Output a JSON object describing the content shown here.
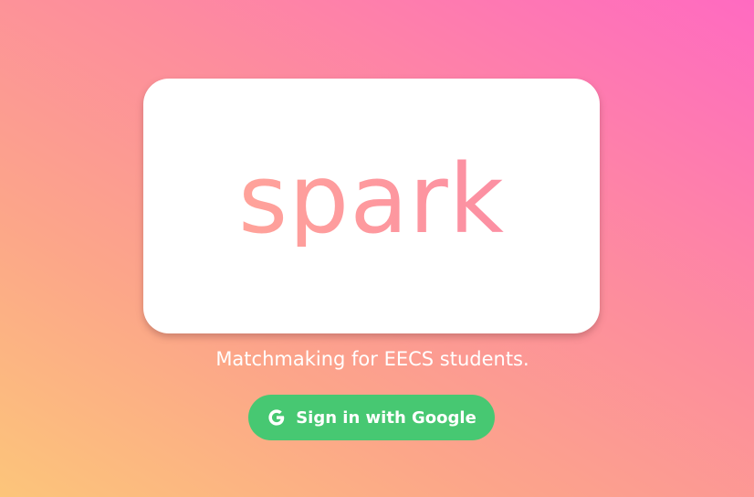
{
  "app": {
    "logo_text": "spark",
    "tagline": "Matchmaking for EECS students."
  },
  "auth": {
    "google_button_label": "Sign in with Google",
    "google_icon": "google-g-icon"
  },
  "colors": {
    "background_start": "#fcc57a",
    "background_end": "#ff6ac1",
    "logo": "#fd9aa0",
    "button": "#47c872",
    "button_text": "#ffffff"
  }
}
